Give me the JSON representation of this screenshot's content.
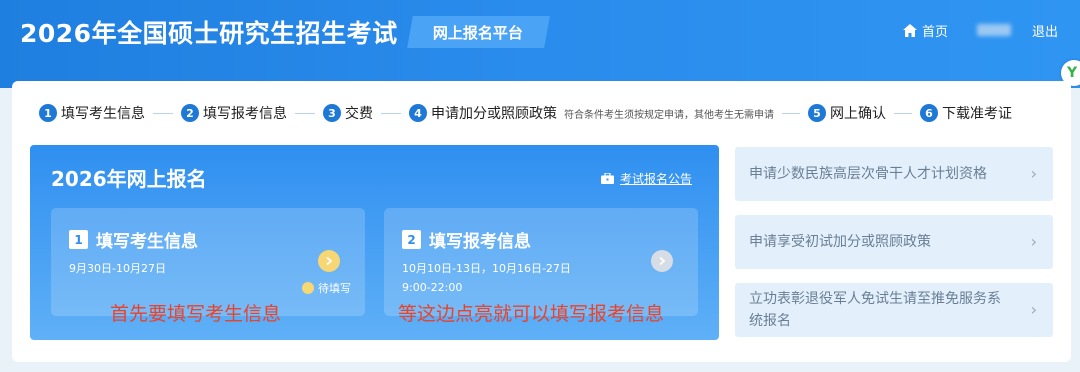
{
  "header": {
    "site_title": "2026年全国硕士研究生招生考试",
    "platform_tag": "网上报名平台",
    "home_label": "首页",
    "logout_label": "退出",
    "badge_text": "Y"
  },
  "steps": [
    {
      "num": "1",
      "label": "填写考生信息"
    },
    {
      "num": "2",
      "label": "填写报考信息"
    },
    {
      "num": "3",
      "label": "交费"
    },
    {
      "num": "4",
      "label": "申请加分或照顾政策",
      "note": "符合条件考生须按规定申请，其他考生无需申请"
    },
    {
      "num": "5",
      "label": "网上确认"
    },
    {
      "num": "6",
      "label": "下载准考证"
    }
  ],
  "main": {
    "title": "2026年网上报名",
    "notice_link": "考试报名公告",
    "card1": {
      "num": "1",
      "title": "填写考生信息",
      "date": "9月30日-10月27日",
      "status": "待填写"
    },
    "card2": {
      "num": "2",
      "title": "填写报考信息",
      "date_line1": "10月10日-13日，10月16日-27日",
      "date_line2": "9:00-22:00"
    },
    "annotation1": "首先要填写考生信息",
    "annotation2": "等这边点亮就可以填写报考信息"
  },
  "sidebar": {
    "items": [
      {
        "label": "申请少数民族高层次骨干人才计划资格"
      },
      {
        "label": "申请享受初试加分或照顾政策"
      },
      {
        "label_line1": "立功表彰退役军人免试生请至推免服务系",
        "label_line2": "统报名"
      }
    ]
  },
  "colors": {
    "header_blue": "#1f7fe0",
    "step_blue": "#1e78d6",
    "annotation_red": "#e8432b",
    "pending_yellow": "#f7d774"
  }
}
